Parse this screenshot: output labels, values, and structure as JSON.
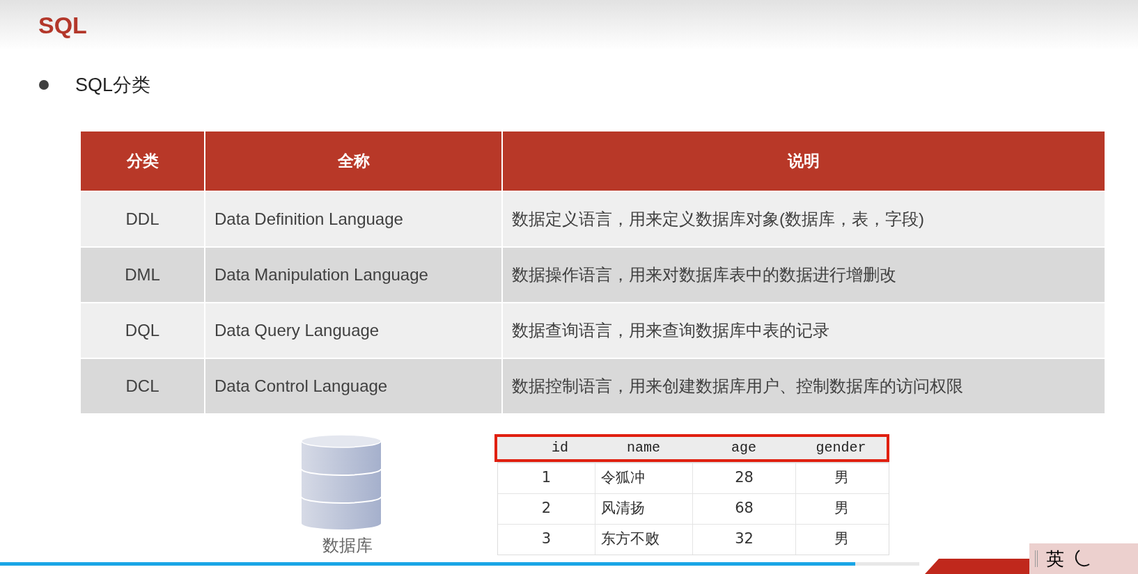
{
  "slide": {
    "title": "SQL",
    "bullet": "SQL分类"
  },
  "table": {
    "columns": [
      "分类",
      "全称",
      "说明"
    ],
    "rows": [
      {
        "cells": [
          "DDL",
          "Data Definition Language",
          "数据定义语言，用来定义数据库对象(数据库，表，字段)"
        ]
      },
      {
        "cells": [
          "DML",
          "Data Manipulation Language",
          "数据操作语言，用来对数据库表中的数据进行增删改"
        ]
      },
      {
        "cells": [
          "DQL",
          "Data Query Language",
          "数据查询语言，用来查询数据库中表的记录"
        ]
      },
      {
        "cells": [
          "DCL",
          "Data Control Language",
          "数据控制语言，用来创建数据库用户、控制数据库的访问权限"
        ]
      }
    ]
  },
  "database_label": "数据库",
  "example_table": {
    "columns": [
      "id",
      "name",
      "age",
      "gender"
    ],
    "rows": [
      {
        "cells": [
          "1",
          "令狐冲",
          "28",
          "男"
        ]
      },
      {
        "cells": [
          "2",
          "风清扬",
          "68",
          "男"
        ]
      },
      {
        "cells": [
          "3",
          "东方不败",
          "32",
          "男"
        ]
      }
    ]
  },
  "ime_bar": {
    "mode": "英"
  },
  "progress": {
    "level": 0.93
  }
}
